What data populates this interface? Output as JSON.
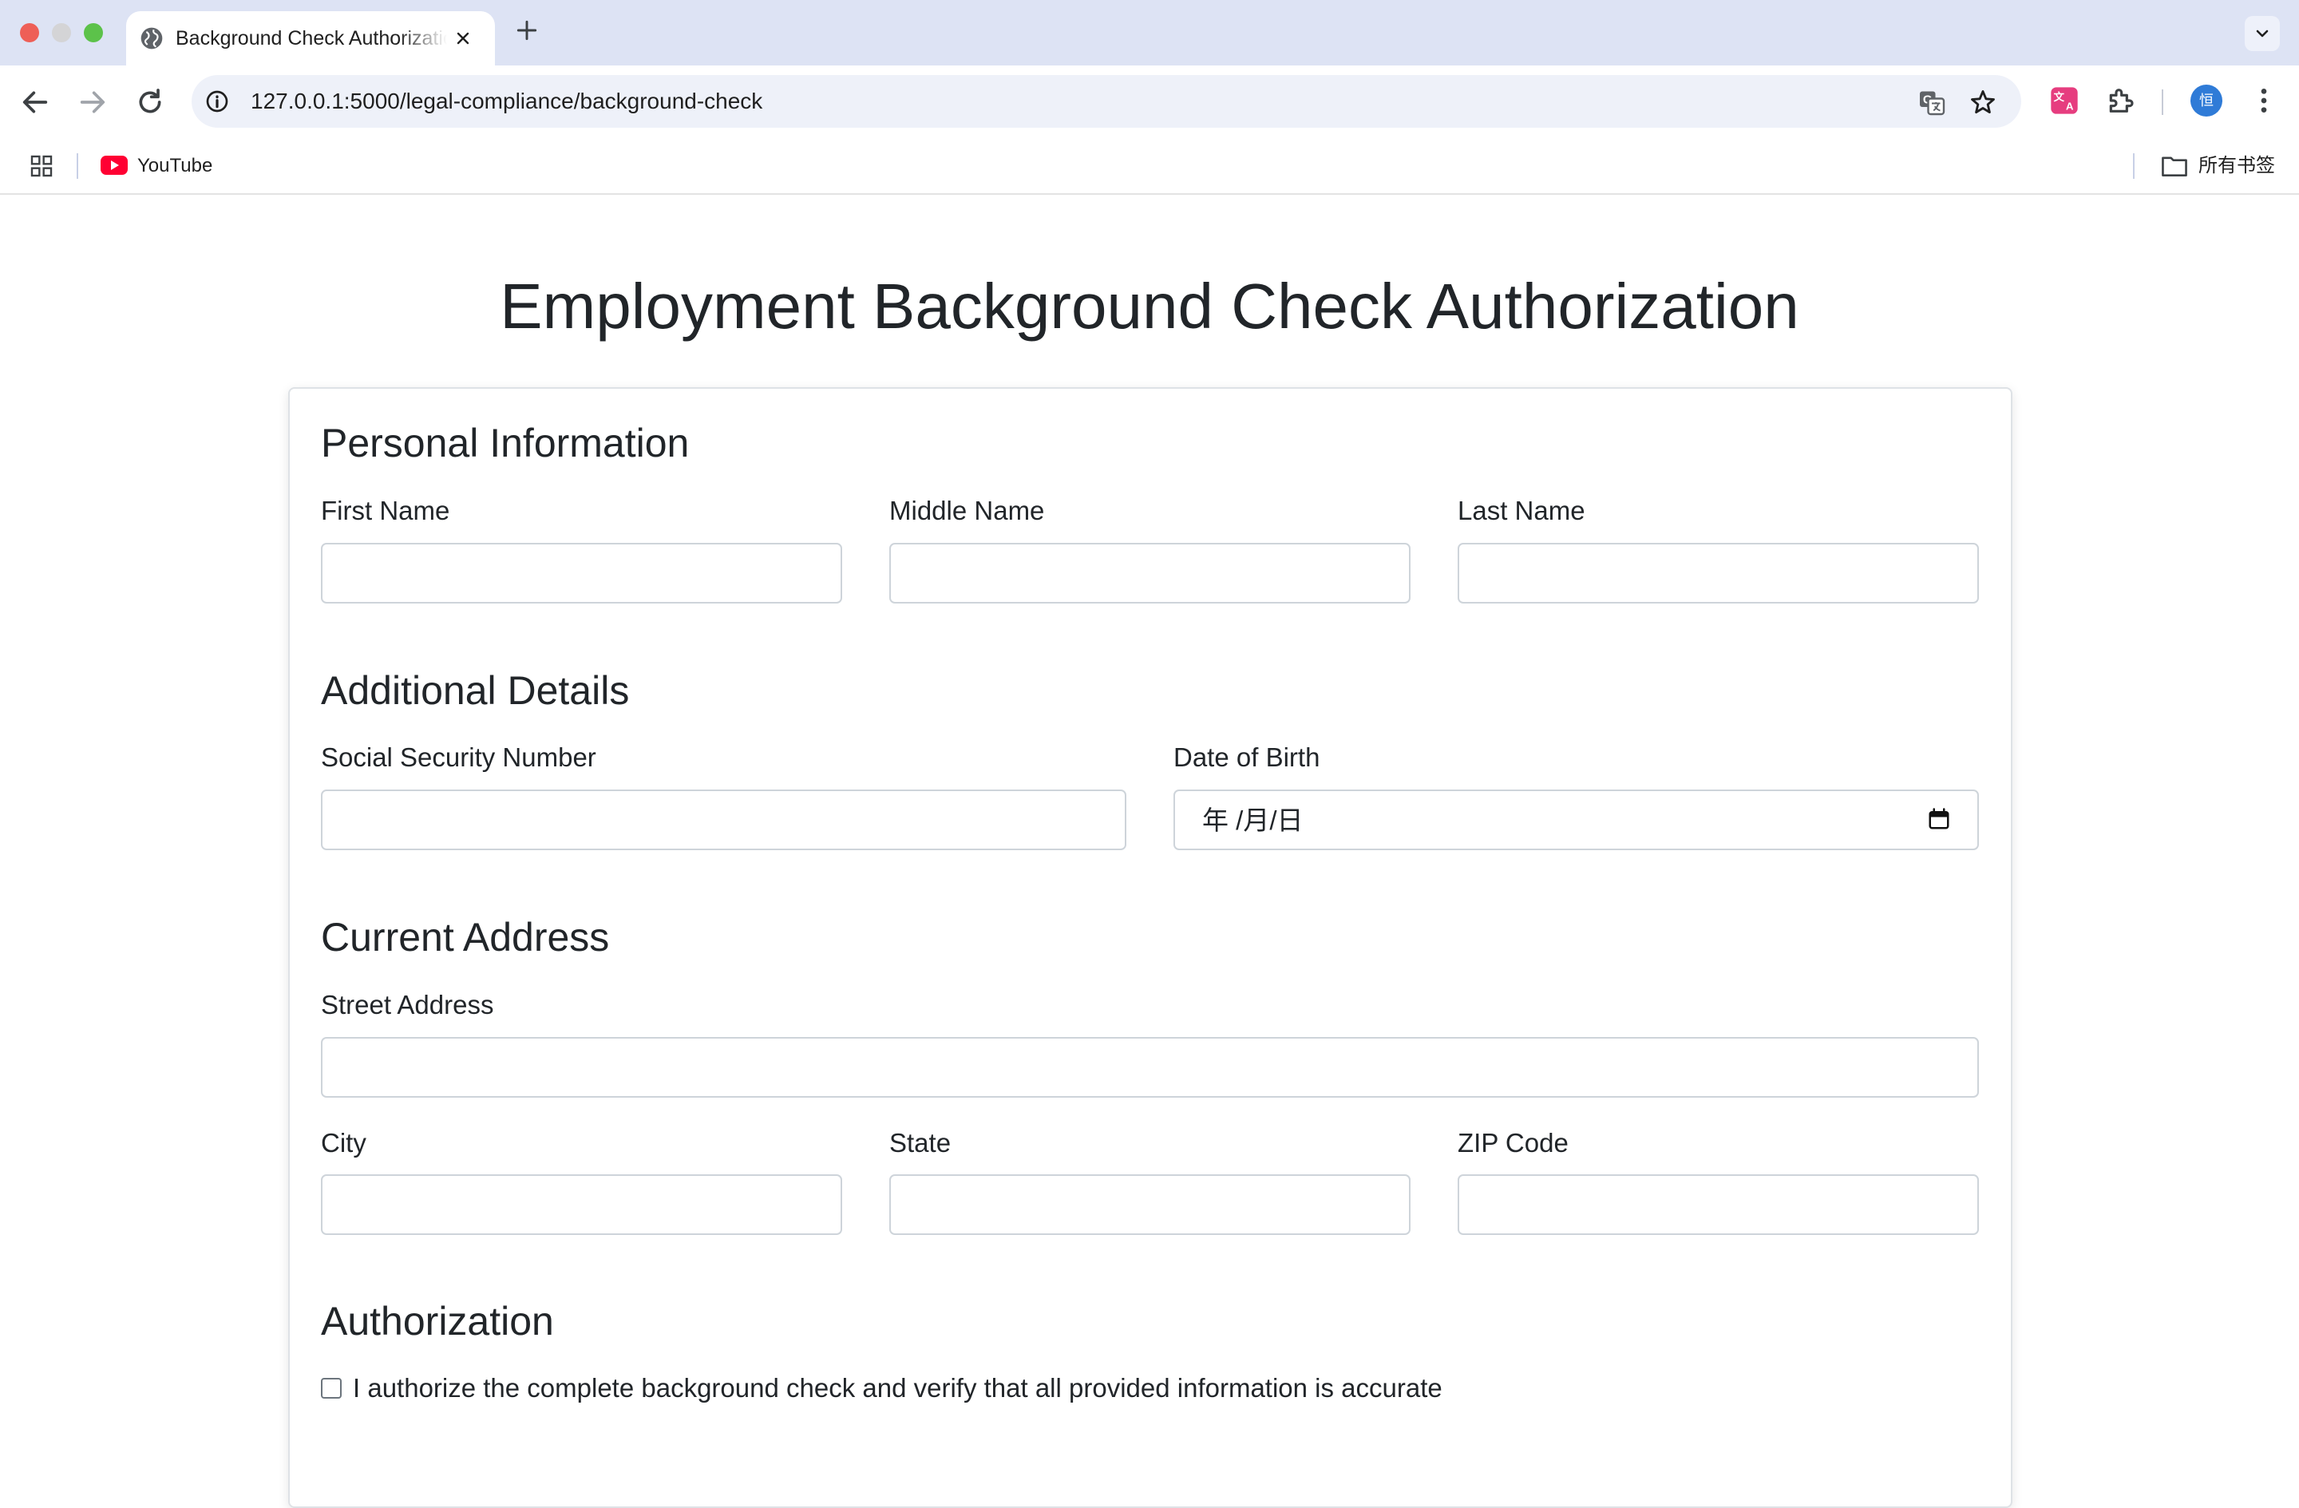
{
  "browser": {
    "tab": {
      "title": "Background Check Authorization",
      "close_glyph": "×"
    },
    "new_tab_glyph": "+",
    "url": "127.0.0.1:5000/legal-compliance/background-check",
    "avatar_label": "恒",
    "bookmarks": {
      "youtube": "YouTube",
      "all_bookmarks": "所有书签"
    }
  },
  "page": {
    "title": "Employment Background Check Authorization",
    "sections": {
      "personal": {
        "title": "Personal Information",
        "first_name": {
          "label": "First Name",
          "value": ""
        },
        "middle_name": {
          "label": "Middle Name",
          "value": ""
        },
        "last_name": {
          "label": "Last Name",
          "value": ""
        }
      },
      "additional": {
        "title": "Additional Details",
        "ssn": {
          "label": "Social Security Number",
          "value": ""
        },
        "dob": {
          "label": "Date of Birth",
          "placeholder": "年 /月/日"
        }
      },
      "address": {
        "title": "Current Address",
        "street": {
          "label": "Street Address",
          "value": ""
        },
        "city": {
          "label": "City",
          "value": ""
        },
        "state": {
          "label": "State",
          "value": ""
        },
        "zip": {
          "label": "ZIP Code",
          "value": ""
        }
      },
      "authorization": {
        "title": "Authorization",
        "consent_label": "I authorize the complete background check and verify that all provided information is accurate",
        "consent_checked": false
      }
    }
  },
  "icons": {
    "tab_favicon": "globe-icon",
    "back": "arrow-left-icon",
    "forward": "arrow-right-icon",
    "reload": "reload-icon",
    "site_info": "info-icon",
    "translate": "translate-icon",
    "bookmark_star": "star-icon",
    "extension_1": "translate-extension-icon",
    "extensions": "puzzle-icon",
    "menu": "kebab-menu-icon",
    "apps": "apps-grid-icon",
    "youtube": "youtube-icon",
    "folder": "folder-icon",
    "calendar": "calendar-icon"
  },
  "colors": {
    "tabstrip_bg": "#dde3f4",
    "omnibox_bg": "#eef1f9",
    "text": "#212529",
    "input_border": "#ced4da",
    "traffic_red": "#ee5f57",
    "traffic_green": "#5cc24a",
    "avatar_blue": "#2f7bd7",
    "youtube_red": "#ff0033"
  }
}
